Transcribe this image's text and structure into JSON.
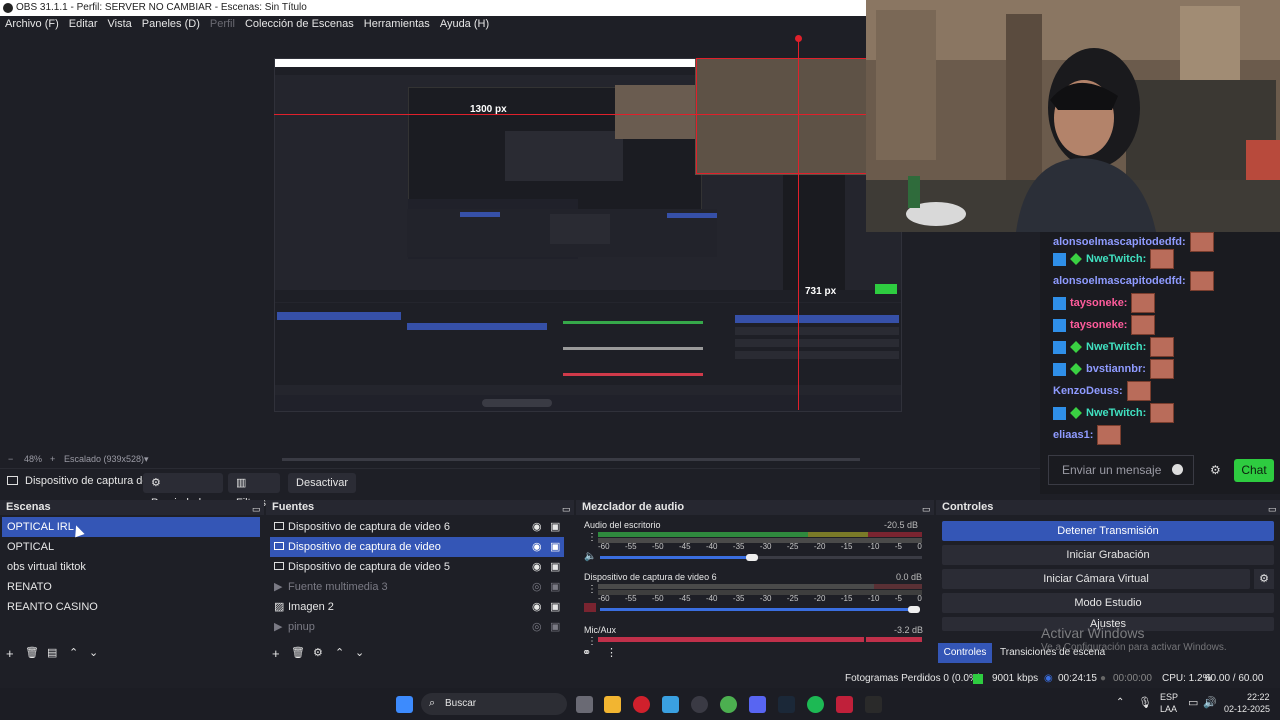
{
  "window": {
    "title": "OBS 31.1.1 - Perfil: SERVER NO CAMBIAR - Escenas: Sin Título"
  },
  "menu": [
    "Archivo (F)",
    "Editar",
    "Vista",
    "Paneles (D)",
    "Perfil",
    "Colección de Escenas",
    "Herramientas",
    "Ayuda (H)"
  ],
  "preview": {
    "measure_top": "1300 px",
    "measure_right": "731 px",
    "zoom": "48%",
    "scaled": "Escalado (939x528)"
  },
  "chat": {
    "messages": [
      {
        "user": "alonsoelmascapitodedfd:",
        "color": "#8f9bff",
        "badges": []
      },
      {
        "user": "NweTwitch:",
        "color": "#40e0c0",
        "badges": [
          "twitch",
          "star"
        ]
      },
      {
        "user": "alonsoelmascapitodedfd:",
        "color": "#8f9bff",
        "badges": []
      },
      {
        "user": "taysoneke:",
        "color": "#ff5c9c",
        "badges": [
          "twitch"
        ]
      },
      {
        "user": "taysoneke:",
        "color": "#ff5c9c",
        "badges": [
          "twitch"
        ]
      },
      {
        "user": "NweTwitch:",
        "color": "#40e0c0",
        "badges": [
          "twitch",
          "star"
        ]
      },
      {
        "user": "bvstiannbr:",
        "color": "#8f9bff",
        "badges": [
          "twitch",
          "star"
        ]
      },
      {
        "user": "KenzoDeuss:",
        "color": "#8f9bff",
        "badges": []
      },
      {
        "user": "NweTwitch:",
        "color": "#40e0c0",
        "badges": [
          "twitch",
          "star"
        ]
      },
      {
        "user": "eliaas1:",
        "color": "#8f9bff",
        "badges": []
      }
    ],
    "input_placeholder": "Enviar un mensaje",
    "chat_button": "Chat"
  },
  "source_toolbar": {
    "current_source": "Dispositivo de captura de v",
    "properties": "Propiedades",
    "filters": "Filtros",
    "deactivate": "Desactivar"
  },
  "scenes": {
    "title": "Escenas",
    "items": [
      "OPTICAL IRL",
      "OPTICAL",
      "obs virtual tiktok",
      "RENATO",
      "REANTO CASINO"
    ],
    "selected": 0
  },
  "sources": {
    "title": "Fuentes",
    "items": [
      {
        "label": "Dispositivo de captura de video 6",
        "visible": true,
        "icon": "monitor-icon"
      },
      {
        "label": "Dispositivo de captura de video",
        "visible": true,
        "icon": "monitor-icon",
        "selected": true
      },
      {
        "label": "Dispositivo de captura de video 5",
        "visible": true,
        "icon": "monitor-icon"
      },
      {
        "label": "Fuente multimedia 3",
        "visible": false,
        "icon": "play-icon"
      },
      {
        "label": "Imagen 2",
        "visible": true,
        "icon": "image-icon"
      },
      {
        "label": "pinup",
        "visible": false,
        "icon": "play-icon"
      }
    ]
  },
  "mixer": {
    "title": "Mezclador de audio",
    "channels": [
      {
        "name": "Audio del escritorio",
        "db": "-20.5 dB",
        "level": 0.78
      },
      {
        "name": "Dispositivo de captura de video 6",
        "db": "0.0 dB",
        "level": 0.0
      },
      {
        "name": "Mic/Aux",
        "db": "-3.2 dB",
        "level": 0.0
      }
    ],
    "scale": [
      "-60",
      "-55",
      "-50",
      "-45",
      "-40",
      "-35",
      "-30",
      "-25",
      "-20",
      "-15",
      "-10",
      "-5",
      "0"
    ]
  },
  "controls": {
    "title": "Controles",
    "stop_stream": "Detener Transmisión",
    "start_recording": "Iniciar Grabación",
    "start_virtual_cam": "Iniciar Cámara Virtual",
    "studio_mode": "Modo Estudio",
    "settings": "Ajustes",
    "tab_controls": "Controles",
    "tab_transitions": "Transiciones de escena"
  },
  "watermark": {
    "title": "Activar Windows",
    "subtitle": "Ve a Configuración para activar Windows."
  },
  "status": {
    "dropped_frames": "Fotogramas Perdidos 0 (0.0%)",
    "bitrate": "9001 kbps",
    "stream_time": "00:24:15",
    "rec_time": "00:00:00",
    "cpu": "CPU: 1.2%",
    "fps": "60.00 / 60.00 FPS"
  },
  "taskbar": {
    "search": "Buscar",
    "lang": "ESP",
    "layout": "LAA",
    "time": "22:22",
    "date": "02-12-2025"
  },
  "colors": {
    "accent": "#3456b6",
    "chat_green": "#2ecc40",
    "stream_red": "#e0202b"
  }
}
